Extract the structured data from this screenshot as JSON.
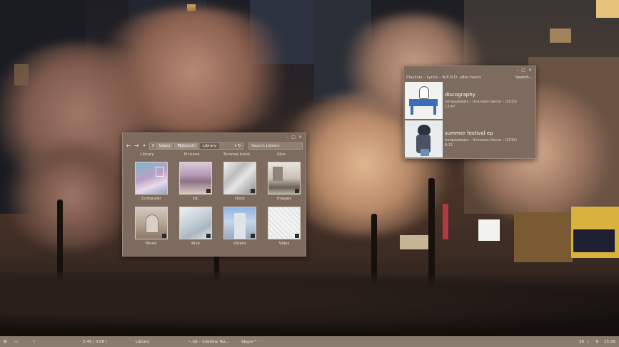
{
  "file_manager": {
    "path": [
      "Users",
      "Mokocchi",
      "Library"
    ],
    "search_placeholder": "Search Library",
    "places": [
      "Library",
      "Pictures",
      "Tommie Icons",
      "Rice"
    ],
    "items": [
      {
        "label": "Computer"
      },
      {
        "label": "DL"
      },
      {
        "label": "Dock"
      },
      {
        "label": "Images"
      },
      {
        "label": "Music"
      },
      {
        "label": "Rice"
      },
      {
        "label": "Videos"
      },
      {
        "label": "Vidys"
      }
    ]
  },
  "music_player": {
    "title": "Playlists – Lyrics – N.E.R.D. after hours",
    "search_label": "Search...",
    "albums": [
      {
        "name": "discography",
        "meta": "tompaabeats – Unknown Genre – (2015)",
        "duration": "13:47"
      },
      {
        "name": "summer festival ep",
        "meta": "tompaabeats – Unknown Genre – (2015)",
        "duration": "8:15"
      }
    ]
  },
  "taskbar": {
    "play_glyph": "II",
    "progress": "2:45 / 3:08 /",
    "items": [
      "Library",
      "~.txt – Sublime Tex...",
      "Skype™"
    ],
    "tray_count": "36",
    "clock": "15:36"
  }
}
